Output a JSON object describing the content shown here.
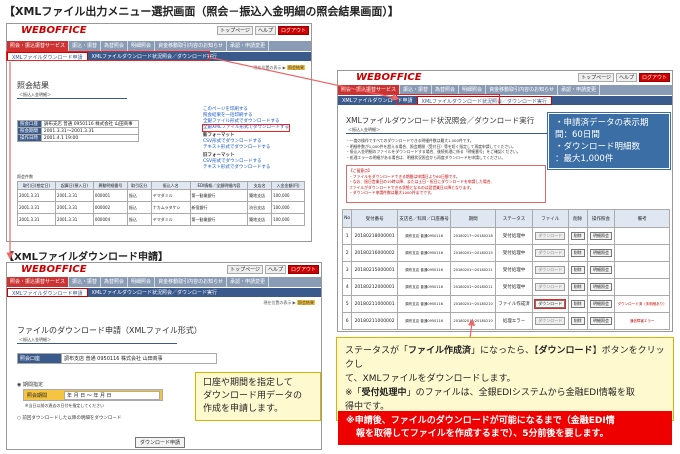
{
  "page_title": "【XMLファイル出力メニュー選択画面（照会－振込入金明細の照会結果画面）】",
  "section2_title": "【XMLファイルダウンロード申請】",
  "app": {
    "logo": "WEBOFFICE",
    "topbtns": [
      "トップページ",
      "ヘルプ",
      "ログアウト"
    ],
    "tabs": [
      "照会・振込振替サービス",
      "振込・振替",
      "為替照会",
      "明細照会",
      "資金移動取引内容のお知らせ",
      "承認・申請変更"
    ],
    "subtabs": [
      "XMLファイルダウンロード申請",
      "XMLファイルダウンロード状況照会／ダウンロード実行"
    ],
    "crumb": "現在位置の表示",
    "crumb_mark": "照会結果"
  },
  "win1": {
    "heading": "照会結果",
    "sub": "＜振込入金明細＞",
    "info": [
      {
        "k": "照会口座",
        "v": "調布支店 普通 0950116 株式会社 山田商事"
      },
      {
        "k": "照会期間",
        "v": "2001.3.31〜2001.3.31"
      },
      {
        "k": "操作日時",
        "v": "2001.4.1 19:00"
      }
    ],
    "links": [
      {
        "t": "このページを印刷する",
        "h": false
      },
      {
        "t": "照会結果を一括印刷する",
        "h": false
      },
      {
        "t": "全銀ファイル形式でダウンロードする",
        "h": false
      },
      {
        "t": "全銀XMLファイル形式でダウンロードする",
        "h": false
      },
      {
        "t": "新フォーマット",
        "h": true
      },
      {
        "t": "CSV形式でダウンロードする",
        "h": false
      },
      {
        "t": "テキスト形式でダウンロードする",
        "h": false
      },
      {
        "t": "旧フォーマット",
        "h": true
      },
      {
        "t": "CSV形式でダウンロードする",
        "h": false
      },
      {
        "t": "テキスト形式でダウンロードする",
        "h": false
      }
    ],
    "count_label": "照会件数",
    "headers": [
      "取引日(勘定日)",
      "起算日(預入日)",
      "異動明細番号",
      "取引区分",
      "振込人名",
      "EDI情報／全銀明細内容",
      "支店名",
      "入金金額(円)"
    ],
    "rows": [
      [
        "2001.3.31",
        "2001.3.31",
        "000001",
        "振込",
        "ヤマダミル",
        "第一勧業銀行",
        "築地支店",
        "100,000"
      ],
      [
        "2001.3.31",
        "2001.3.31",
        "000002",
        "振込",
        "ナカムラタケシ",
        "新宿銀行",
        "渋谷支店",
        "100,000"
      ],
      [
        "2001.3.31",
        "2001.3.31",
        "000004",
        "振込",
        "ヤマダミル",
        "第一勧業銀行",
        "築地支店",
        "100,000"
      ]
    ]
  },
  "win2": {
    "heading": "XMLファイルダウンロード状況照会／ダウンロード実行",
    "sub": "＜振込入金明細＞",
    "desc": [
      "・一度の操作ですべてのダウンロードできる明細件数は最大1,000件です。",
      "・明細件数が1,000件を超える場合、照会期間（受付日）等を短く指定して再度申請してください。",
      "・振込入金明細のファイルをダウンロードする場合、後続処理に係る「明細番号」をご確認ください。",
      "・処理エラーの明細がある場合は、明細状況照会から再度ダウンロードを申請してください。"
    ],
    "notes_title": "【ご留意点】",
    "notes": [
      "・ファイルをダウンロードできる期間は申請日より60日間です。",
      "・なお、過日営業日の19時以降、または土日・祝日にダウンロードを申請した場合、",
      "  ファイルがダウンロードできる状態となるのは翌営業日以降となります。",
      "・ダウンロード申請件数は最大1000件までです。"
    ],
    "headers": [
      "No",
      "受付番号",
      "支店名／科目／口座番号",
      "期間",
      "ステータス",
      "ファイル",
      "削除",
      "操作照会",
      "備考"
    ],
    "rows": [
      [
        "1",
        "20180218000001",
        "調布支店 普通0950116",
        "20180217〜20180218",
        "受付処理中",
        "ダウンロード",
        "削除",
        "明細照会",
        ""
      ],
      [
        "2",
        "20180216000002",
        "調布支店 普通0950116",
        "20180201〜20180215",
        "受付処理中",
        "ダウンロード",
        "削除",
        "明細照会",
        ""
      ],
      [
        "3",
        "20180215000001",
        "調布支店 普通0950116",
        "20180201〜20180211",
        "受付処理中",
        "ダウンロード",
        "削除",
        "明細照会",
        ""
      ],
      [
        "4",
        "20180212000001",
        "調布支店 普通0950116",
        "20180201〜20180211",
        "受付処理中",
        "ダウンロード",
        "削除",
        "明細照会",
        ""
      ],
      [
        "5",
        "20180211000001",
        "調布支店 普通0950116",
        "20180201〜20180210",
        "ファイル作成済",
        "ダウンロード",
        "削除",
        "明細照会",
        "ダウンロード済（未明細あり）"
      ],
      [
        "6",
        "20180211000002",
        "調布支店 普通0950116",
        "20180201〜20180210",
        "処理エラー",
        "ダウンロード",
        "削除",
        "明細照会",
        "通信障害エラー"
      ]
    ]
  },
  "win3": {
    "heading": "ファイルのダウンロード申請（XMLファイル形式）",
    "sub": "＜振込入金明細＞",
    "acct_label": "照会口座",
    "acct_value": "調布支店 普通 0950116 株式会社 山田商事",
    "period_opt": "期間指定",
    "period_label": "照会期間",
    "period_value": "年 月 日 〜 年 月 日",
    "period_hint": "※当日以前の過去の日付を指定してください",
    "prev_opt": "前回ダウンロードした以降の明細をダウンロード",
    "submit": "ダウンロード申請"
  },
  "callouts": {
    "blue": [
      "・申請済データの表示期",
      "間：60日間",
      "・ダウンロード明細数",
      "：最大1,000件"
    ],
    "yellow_left": [
      "口座や期間を指定して",
      "ダウンロード用データの",
      "作成を申請します。"
    ],
    "yellow_main": {
      "l1a": "ステータスが「",
      "l1b": "ファイル作成済",
      "l1c": "」になったら、【",
      "l1d": "ダウンロード",
      "l1e": "】ボタンをクリックし",
      "l2": "て、XMLファイルをダウンロードします。",
      "l3a": "※「",
      "l3b": "受付処理中",
      "l3c": "」のファイルは、全銀EDIシステムから金融EDI情報を取",
      "l4": "得中です。"
    },
    "red": [
      "※申請後、ファイルのダウンロードが可能になるまで（金融EDI情",
      "報を取得してファイルを作成するまで）、5分前後を要します。"
    ]
  }
}
